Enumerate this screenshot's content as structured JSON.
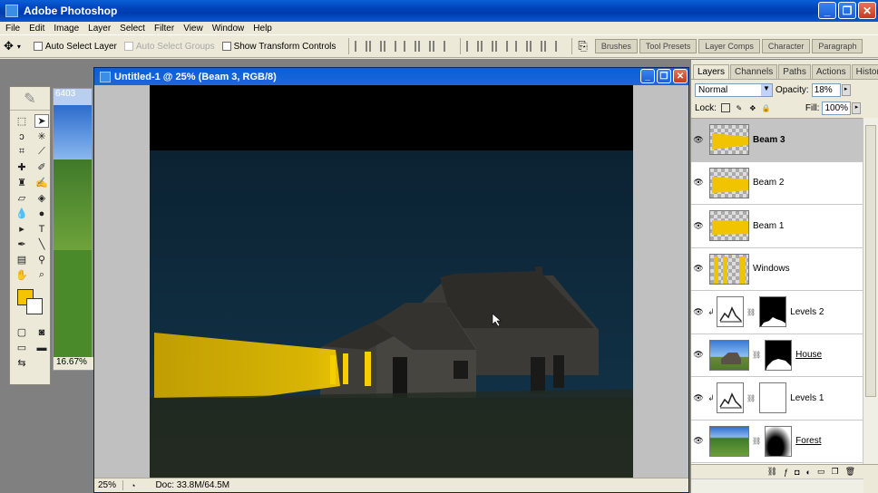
{
  "app": {
    "title": "Adobe Photoshop"
  },
  "window_buttons": {
    "minimize": "_",
    "restore": "❐",
    "close": "✕"
  },
  "menu": [
    "File",
    "Edit",
    "Image",
    "Layer",
    "Select",
    "Filter",
    "View",
    "Window",
    "Help"
  ],
  "options": {
    "auto_select_layer": "Auto Select Layer",
    "auto_select_groups": "Auto Select Groups",
    "show_transform_controls": "Show Transform Controls"
  },
  "palette_well": [
    "Brushes",
    "Tool Presets",
    "Layer Comps",
    "Character",
    "Paragraph"
  ],
  "background_doc": {
    "title": "6403",
    "zoom": "16.67%"
  },
  "document": {
    "title": "Untitled-1 @ 25% (Beam 3, RGB/8)",
    "zoom": "25%",
    "doc_info": "Doc: 33.8M/64.5M"
  },
  "layers_panel": {
    "tabs": [
      "Layers",
      "Channels",
      "Paths",
      "Actions",
      "History"
    ],
    "blend_mode": "Normal",
    "opacity_label": "Opacity:",
    "opacity": "18%",
    "lock_label": "Lock:",
    "fill_label": "Fill:",
    "fill": "100%",
    "layers": [
      {
        "name": "Beam 3",
        "selected": true
      },
      {
        "name": "Beam 2"
      },
      {
        "name": "Beam 1"
      },
      {
        "name": "Windows"
      },
      {
        "name": "Levels 2"
      },
      {
        "name": "House"
      },
      {
        "name": "Levels 1"
      },
      {
        "name": "Forest"
      }
    ]
  },
  "colors": {
    "foreground": "#f5c400",
    "background": "#ffffff",
    "beam": "#e8c000",
    "sky": "#0d2a3e"
  }
}
